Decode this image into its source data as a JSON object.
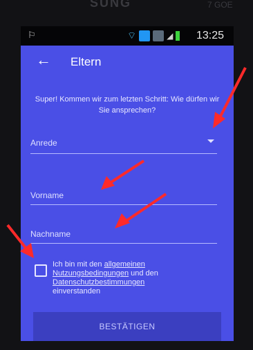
{
  "device": {
    "brand": "SUNG",
    "corner_text": "7 GOE"
  },
  "statusbar": {
    "time": "13:25",
    "left_icon": "notification-icon"
  },
  "toolbar": {
    "back_icon": "←",
    "title": "Eltern"
  },
  "intro_text": "Super! Kommen wir zum letzten Schritt: Wie dürfen wir Sie ansprechen?",
  "form": {
    "salutation_label": "Anrede",
    "firstname_label": "Vorname",
    "lastname_label": "Nachname"
  },
  "terms": {
    "prefix": "Ich bin mit den ",
    "link1": "allgemeinen Nutzungsbedingungen",
    "middle": " und den ",
    "link2": "Datenschutzbestimmungen",
    "suffix": " einverstanden"
  },
  "confirm_label": "BESTÄTIGEN",
  "colors": {
    "screen_bg": "#4a4fe6",
    "button_bg": "#3b3fc0",
    "annotation_arrow": "#ff2a2a"
  }
}
